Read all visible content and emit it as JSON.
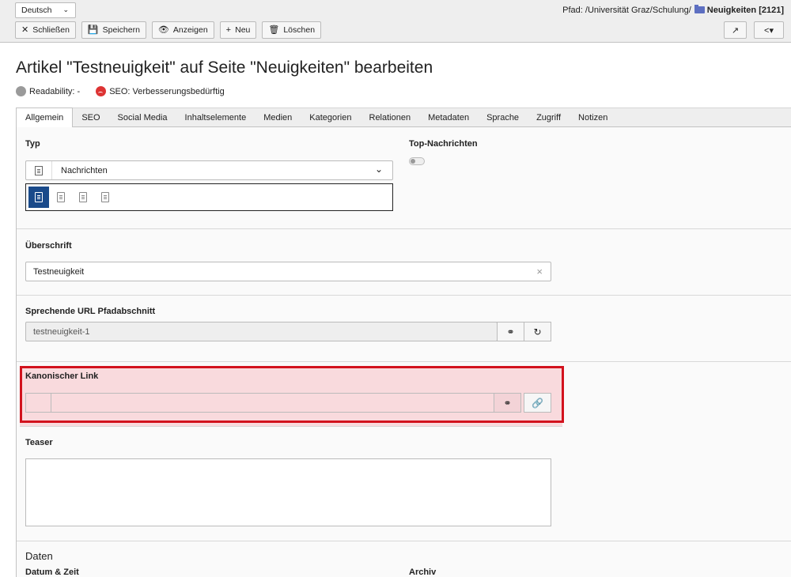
{
  "header": {
    "language": "Deutsch",
    "path_prefix": "Pfad: /Universität Graz/Schulung/",
    "path_page": "Neuigkeiten [2121]",
    "buttons": {
      "close": "Schließen",
      "save": "Speichern",
      "view": "Anzeigen",
      "new": "Neu",
      "delete": "Löschen"
    }
  },
  "page": {
    "title": "Artikel \"Testneuigkeit\" auf Seite \"Neuigkeiten\" bearbeiten",
    "readability": "Readability: -",
    "seo": "SEO: Verbesserungsbedürftig"
  },
  "tabs": [
    "Allgemein",
    "SEO",
    "Social Media",
    "Inhaltselemente",
    "Medien",
    "Kategorien",
    "Relationen",
    "Metadaten",
    "Sprache",
    "Zugriff",
    "Notizen"
  ],
  "form": {
    "typ_label": "Typ",
    "typ_value": "Nachrichten",
    "top_label": "Top-Nachrichten",
    "ueberschrift_label": "Überschrift",
    "ueberschrift_value": "Testneuigkeit",
    "url_label": "Sprechende URL Pfadabschnitt",
    "url_value": "testneuigkeit-1",
    "kanon_label": "Kanonischer Link",
    "kanon_value": "",
    "teaser_label": "Teaser",
    "daten_heading": "Daten",
    "datum_label": "Datum & Zeit",
    "archiv_label": "Archiv"
  }
}
